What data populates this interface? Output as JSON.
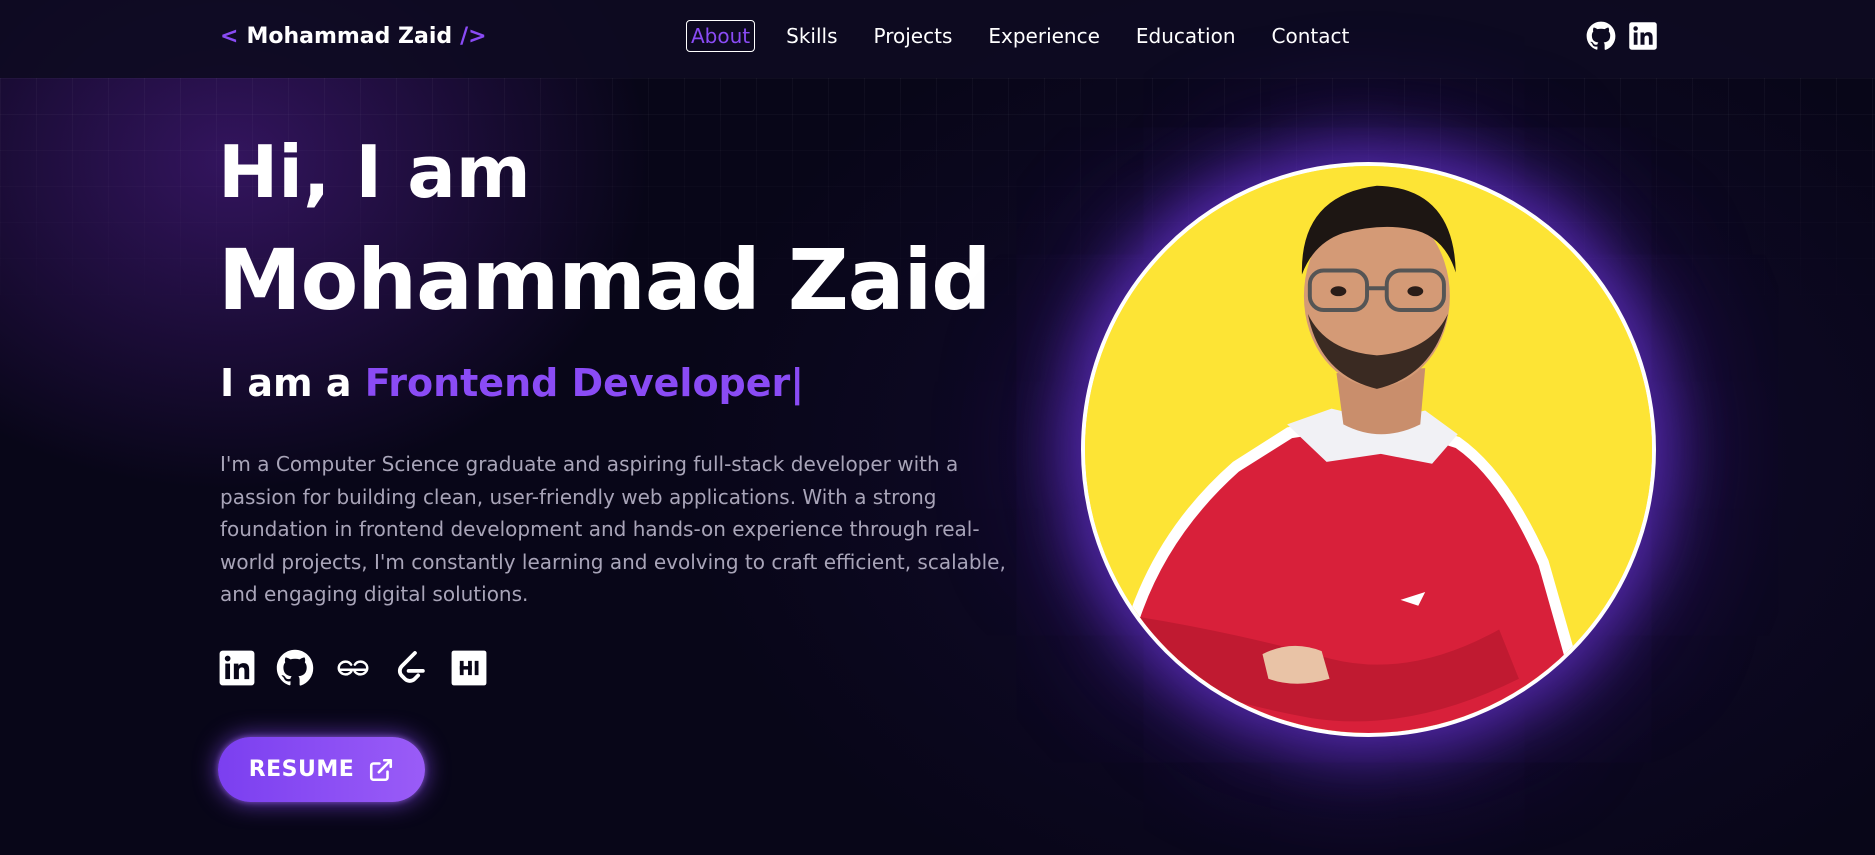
{
  "navbar": {
    "logo": {
      "open": "<",
      "name": "Mohammad Zaid",
      "close": "/>"
    },
    "links": [
      {
        "label": "About",
        "active": true
      },
      {
        "label": "Skills",
        "active": false
      },
      {
        "label": "Projects",
        "active": false
      },
      {
        "label": "Experience",
        "active": false
      },
      {
        "label": "Education",
        "active": false
      },
      {
        "label": "Contact",
        "active": false
      }
    ],
    "icons": [
      "github-icon",
      "linkedin-icon"
    ]
  },
  "hero": {
    "greeting": "Hi, I am",
    "name": "Mohammad Zaid",
    "role_prefix": "I am a ",
    "role_highlight": "Frontend Developer",
    "cursor": "|",
    "bio": "I'm a Computer Science graduate and aspiring full-stack developer with a passion for building clean, user-friendly web applications. With a strong foundation in frontend development and hands-on experience through real-world projects, I'm constantly learning and evolving to craft efficient, scalable, and engaging digital solutions.",
    "socials": [
      "linkedin-icon",
      "github-icon",
      "geeksforgeeks-icon",
      "leetcode-icon",
      "hackerrank-icon"
    ],
    "resume_label": "RESUME",
    "resume_icon": "external-link-icon"
  },
  "colors": {
    "accent": "#8a4bf5",
    "background": "#080618",
    "portrait_bg": "#fde435",
    "sweater": "#d8203a"
  }
}
